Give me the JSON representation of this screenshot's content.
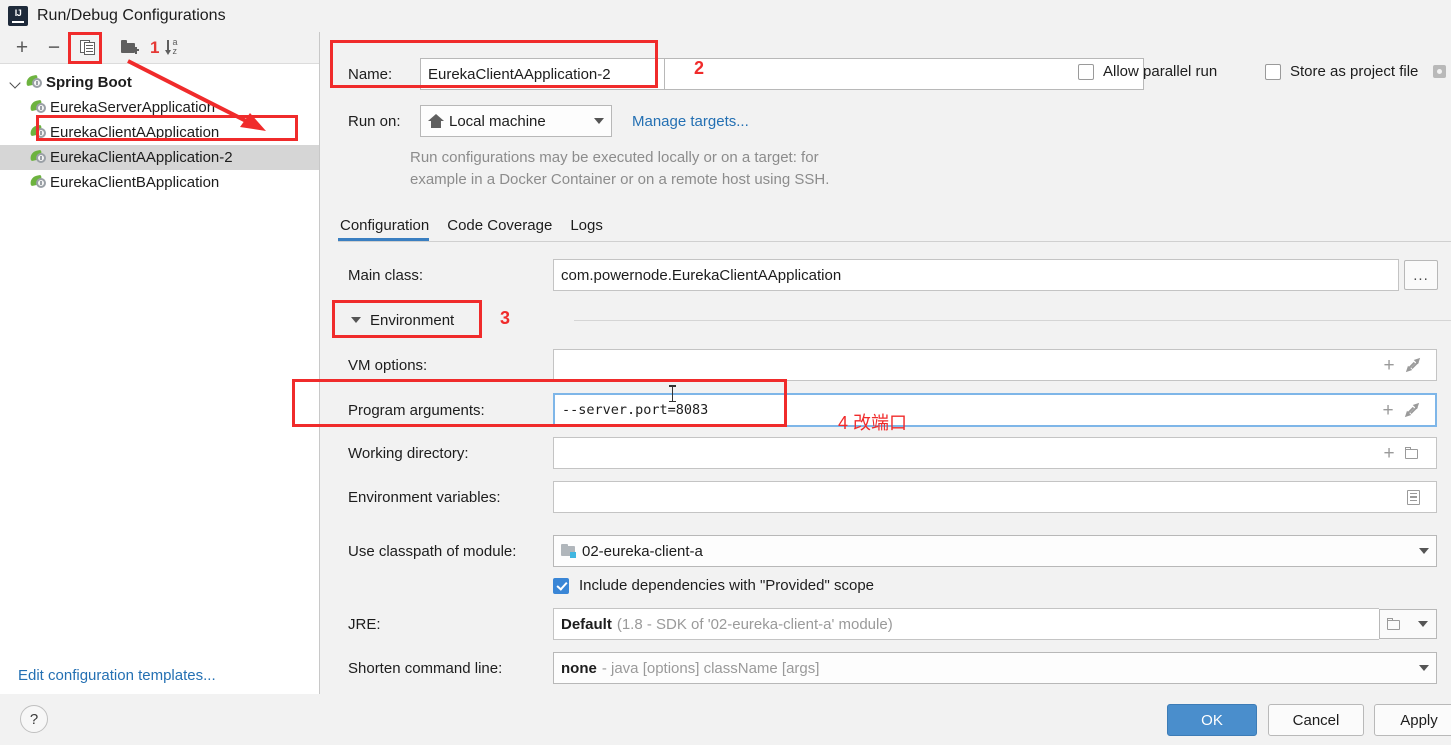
{
  "window": {
    "title": "Run/Debug Configurations",
    "app_icon": "intellij-idea-icon"
  },
  "sidebar": {
    "toolbar": {
      "add_label": "+",
      "remove_label": "−",
      "copy_icon": "copy-configuration-icon",
      "folder_icon": "new-folder-icon",
      "sort_icon": "sort-alphabetically-icon",
      "annotation_1": "1"
    },
    "tree": {
      "group": {
        "label": "Spring Boot",
        "expanded": true,
        "icon": "spring-boot-icon"
      },
      "items": [
        {
          "label": "EurekaServerApplication",
          "selected": false,
          "highlighted": false
        },
        {
          "label": "EurekaClientAApplication",
          "selected": false,
          "highlighted": true
        },
        {
          "label": "EurekaClientAApplication-2",
          "selected": true,
          "highlighted": false
        },
        {
          "label": "EurekaClientBApplication",
          "selected": false,
          "highlighted": false
        }
      ]
    },
    "edit_templates_link": "Edit configuration templates..."
  },
  "form": {
    "name_label": "Name:",
    "name_value": "EurekaClientAApplication-2",
    "annotation_2": "2",
    "allow_parallel_run": {
      "label": "Allow parallel run",
      "checked": false
    },
    "store_as_project_file": {
      "label": "Store as project file",
      "checked": false,
      "gear_icon": "gear-icon"
    },
    "run_on_label": "Run on:",
    "run_on_value": "Local machine",
    "run_on_icon": "home-icon",
    "manage_targets_link": "Manage targets...",
    "description_line1": "Run configurations may be executed locally or on a target: for",
    "description_line2": "example in a Docker Container or on a remote host using SSH.",
    "tabs": [
      {
        "label": "Configuration",
        "active": true
      },
      {
        "label": "Code Coverage",
        "active": false
      },
      {
        "label": "Logs",
        "active": false
      }
    ],
    "main_class_label": "Main class:",
    "main_class_value": "com.powernode.EurekaClientAApplication",
    "main_class_browse": "...",
    "environment_section_label": "Environment",
    "annotation_3": "3",
    "vm_options_label": "VM options:",
    "vm_options_value": "",
    "program_arguments_label": "Program arguments:",
    "program_arguments_value": "--server.port=8083",
    "annotation_4": "4 改端口",
    "working_directory_label": "Working directory:",
    "working_directory_value": "",
    "environment_variables_label": "Environment variables:",
    "environment_variables_value": "",
    "use_classpath_label": "Use classpath of module:",
    "use_classpath_value": "02-eureka-client-a",
    "use_classpath_icon": "module-icon",
    "include_provided": {
      "label": "Include dependencies with \"Provided\" scope",
      "checked": true
    },
    "jre_label": "JRE:",
    "jre_value": "Default",
    "jre_hint": "(1.8 - SDK of '02-eureka-client-a' module)",
    "shorten_label": "Shorten command line:",
    "shorten_value": "none",
    "shorten_hint": "- java [options] className [args]"
  },
  "footer": {
    "help_label": "?",
    "ok_label": "OK",
    "cancel_label": "Cancel",
    "apply_label": "Apply"
  },
  "colors": {
    "accent_blue": "#4a8ecc",
    "link_blue": "#2470b3",
    "annotation_red": "#f02b2b",
    "selection_gray": "#d6d6d6",
    "spring_green": "#6db33f"
  }
}
